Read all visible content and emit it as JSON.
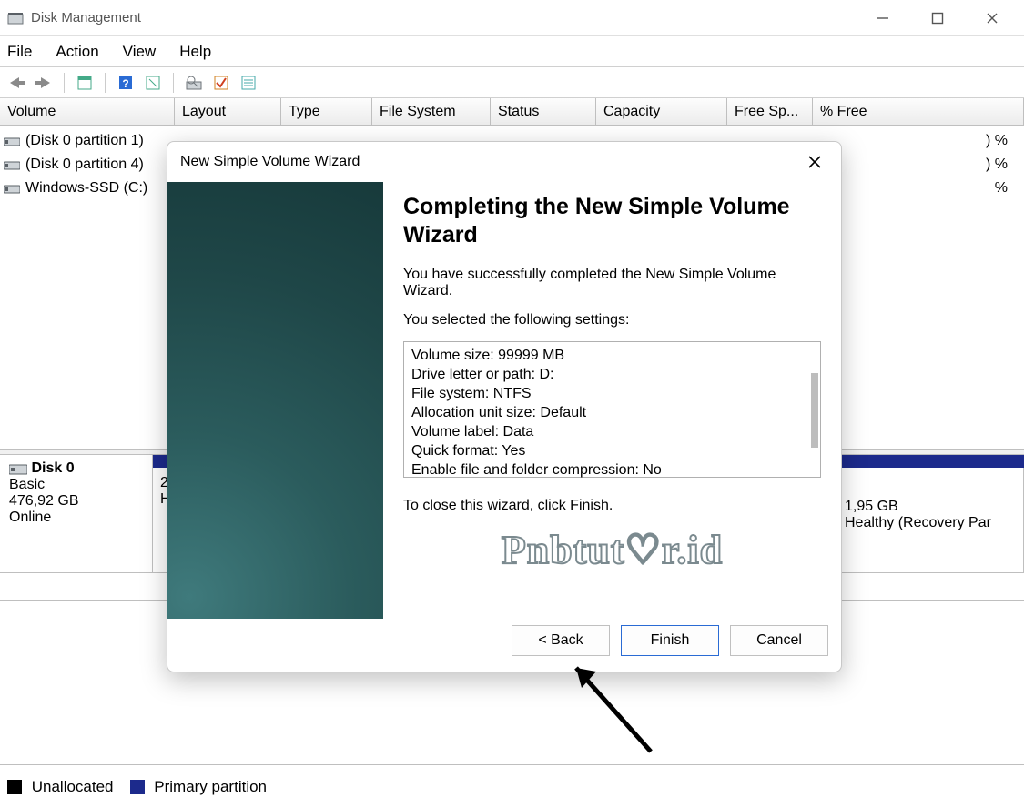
{
  "window": {
    "title": "Disk Management"
  },
  "menu": {
    "file": "File",
    "action": "Action",
    "view": "View",
    "help": "Help"
  },
  "columns": {
    "volume": "Volume",
    "layout": "Layout",
    "type": "Type",
    "fs": "File System",
    "status": "Status",
    "capacity": "Capacity",
    "free": "Free Sp...",
    "pct": "% Free"
  },
  "volumes": [
    {
      "name": "(Disk 0 partition 1)",
      "pct_stub": ") %"
    },
    {
      "name": "(Disk 0 partition 4)",
      "pct_stub": ") %"
    },
    {
      "name": "Windows-SSD (C:)",
      "pct_stub": "%"
    }
  ],
  "disk": {
    "name": "Disk 0",
    "type": "Basic",
    "size": "476,92 GB",
    "status": "Online",
    "part_left_hint": "2",
    "part_left_hint2": "H",
    "part_right_size": "1,95 GB",
    "part_right_status": "Healthy (Recovery Par"
  },
  "legend": {
    "unalloc": "Unallocated",
    "primary": "Primary partition"
  },
  "wizard": {
    "title": "New Simple Volume Wizard",
    "heading": "Completing the New Simple Volume Wizard",
    "success": "You have successfully completed the New Simple Volume Wizard.",
    "selected_intro": "You selected the following settings:",
    "settings": [
      "Volume size: 99999 MB",
      "Drive letter or path: D:",
      "File system: NTFS",
      "Allocation unit size: Default",
      "Volume label: Data",
      "Quick format: Yes",
      "Enable file and folder compression: No"
    ],
    "close_hint": "To close this wizard, click Finish.",
    "back": "< Back",
    "finish": "Finish",
    "cancel": "Cancel"
  },
  "watermark": "Pnbtut♡r.id"
}
